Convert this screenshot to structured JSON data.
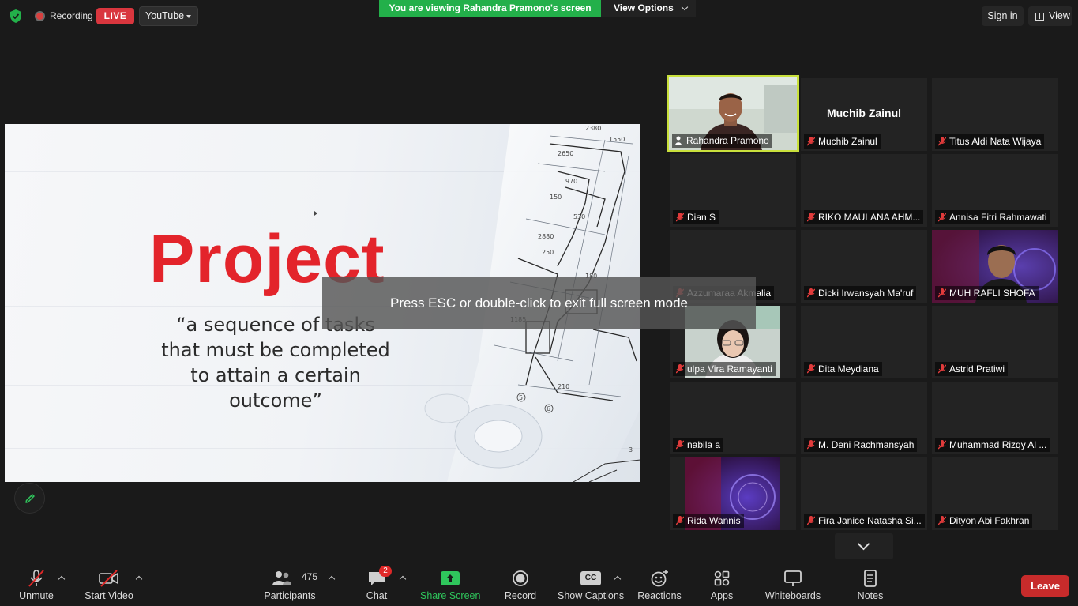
{
  "top_bar": {
    "recording_label": "Recording",
    "live_label": "LIVE",
    "stream_target": "YouTube",
    "viewing_banner": "You are viewing Rahandra Pramono's screen",
    "view_options_label": "View Options",
    "sign_in_label": "Sign in",
    "view_label": "View",
    "colors": {
      "banner_green": "#23b04a",
      "live_red": "#d9363e"
    }
  },
  "slide": {
    "title": "Project",
    "quote_lines": [
      "“a sequence of tasks",
      "that must be completed",
      "to attain a certain",
      "outcome”"
    ],
    "title_color": "#e3242b"
  },
  "overlay": {
    "esc_message": "Press ESC or double-click to exit full screen mode"
  },
  "gallery": {
    "active_speaker_color": "#c9e03c",
    "featured_name_display": "Muchib Zainul",
    "participants": [
      "Rahandra Pramono",
      "Muchib Zainul",
      "Titus Aldi Nata Wijaya",
      "Dian S",
      "RIKO MAULANA AHM...",
      "Annisa Fitri Rahmawati",
      "Azzumaraa Akmalia",
      "Dicki Irwansyah Ma'ruf",
      "MUH RAFLI SHOFA",
      "ulpa Vira Ramayanti",
      "Dita Meydiana",
      "Astrid Pratiwi",
      "nabila a",
      "M. Deni Rachmansyah",
      "Muhammad Rizqy Al ...",
      "Rida Wannis",
      "Fira Janice Natasha Si...",
      "Dityon Abi Fakhran"
    ]
  },
  "toolbar": {
    "unmute": "Unmute",
    "start_video": "Start Video",
    "participants": "Participants",
    "participant_count": "475",
    "chat": "Chat",
    "chat_badge": "2",
    "share_screen": "Share Screen",
    "record": "Record",
    "show_captions": "Show Captions",
    "captions_icon_text": "CC",
    "reactions": "Reactions",
    "apps": "Apps",
    "whiteboards": "Whiteboards",
    "notes": "Notes",
    "leave": "Leave",
    "colors": {
      "share_green": "#2fc65c",
      "leave_red": "#c72b2b"
    }
  }
}
